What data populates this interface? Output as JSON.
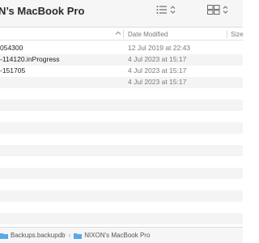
{
  "window": {
    "title": "N’s MacBook Pro"
  },
  "toolbar": {
    "list_view_icon": "list-icon",
    "grid_view_icon": "grid-icon"
  },
  "columns": {
    "date_modified": "Date Modified",
    "size": "Size"
  },
  "rows": [
    {
      "name": "054300",
      "date": "12 Jul 2019 at 22:43"
    },
    {
      "name": "-114120.inProgress",
      "date": "4 Jul 2023 at 15:17"
    },
    {
      "name": "-151705",
      "date": "4 Jul 2023 at 15:17"
    },
    {
      "name": "",
      "date": "4 Jul 2023 at 15:17"
    }
  ],
  "pathbar": {
    "items": [
      {
        "label": "Backups.backupdb"
      },
      {
        "label": "NIXON's MacBook Pro"
      }
    ]
  },
  "colors": {
    "folder": "#5aa9e6",
    "stripe": "#f4f4f4"
  }
}
